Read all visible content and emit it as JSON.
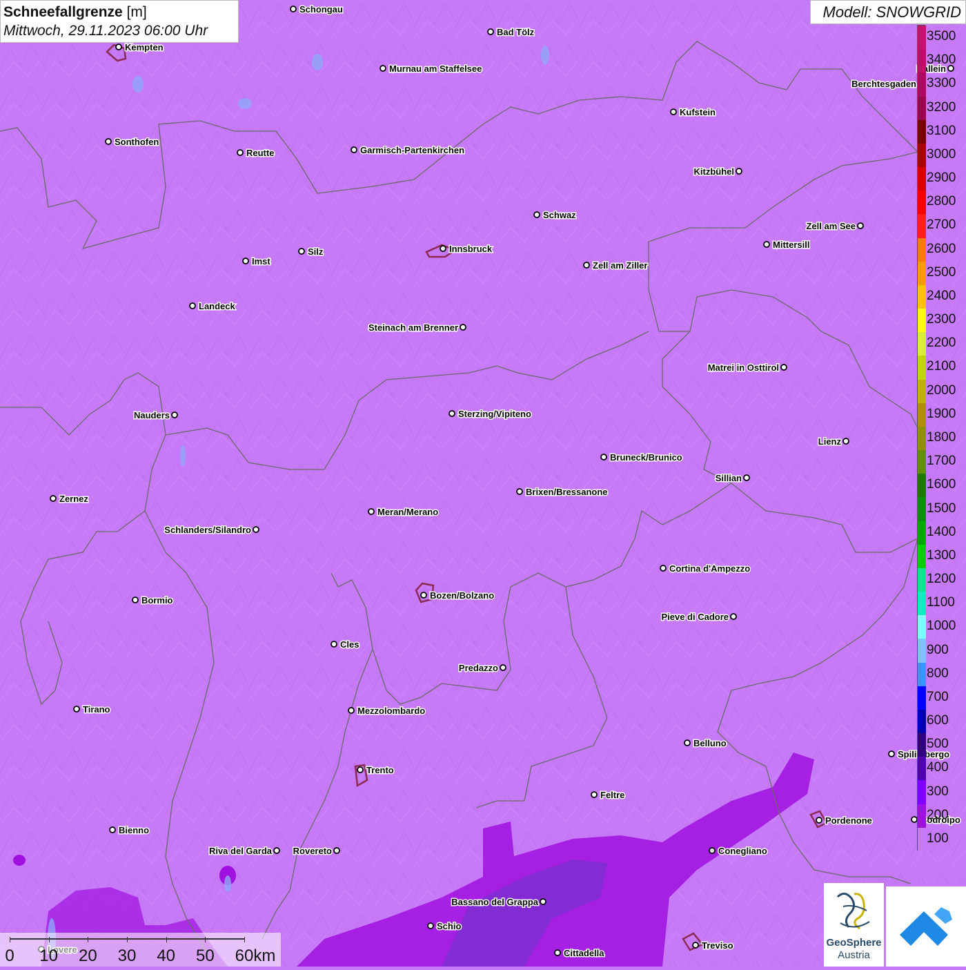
{
  "title": {
    "main": "Schneefallgrenze",
    "unit": "[m]",
    "datetime": "Mittwoch, 29.11.2023 06:00 Uhr"
  },
  "model": "Modell: SNOWGRID",
  "legend": [
    {
      "value": "3500",
      "color": "#c8106e"
    },
    {
      "value": "3400",
      "color": "#c00c68"
    },
    {
      "value": "3300",
      "color": "#b00860"
    },
    {
      "value": "3200",
      "color": "#9c0450"
    },
    {
      "value": "3100",
      "color": "#7a0000"
    },
    {
      "value": "3000",
      "color": "#a80000"
    },
    {
      "value": "2900",
      "color": "#d00000"
    },
    {
      "value": "2800",
      "color": "#f00000"
    },
    {
      "value": "2700",
      "color": "#ff2020"
    },
    {
      "value": "2600",
      "color": "#ff7a00"
    },
    {
      "value": "2500",
      "color": "#ff9a00"
    },
    {
      "value": "2400",
      "color": "#ffc000"
    },
    {
      "value": "2300",
      "color": "#ffff00"
    },
    {
      "value": "2200",
      "color": "#d8f030"
    },
    {
      "value": "2100",
      "color": "#c0d800"
    },
    {
      "value": "2000",
      "color": "#c0b000"
    },
    {
      "value": "1900",
      "color": "#b09000"
    },
    {
      "value": "1800",
      "color": "#909000"
    },
    {
      "value": "1700",
      "color": "#609000"
    },
    {
      "value": "1600",
      "color": "#207800"
    },
    {
      "value": "1500",
      "color": "#108a10"
    },
    {
      "value": "1400",
      "color": "#00a800"
    },
    {
      "value": "1300",
      "color": "#00d000"
    },
    {
      "value": "1200",
      "color": "#00e890"
    },
    {
      "value": "1100",
      "color": "#00f0c0"
    },
    {
      "value": "1000",
      "color": "#80ffff"
    },
    {
      "value": "900",
      "color": "#80c0ff"
    },
    {
      "value": "800",
      "color": "#4090ff"
    },
    {
      "value": "700",
      "color": "#0000ff"
    },
    {
      "value": "600",
      "color": "#0000b0"
    },
    {
      "value": "500",
      "color": "#300080"
    },
    {
      "value": "400",
      "color": "#5000b0"
    },
    {
      "value": "300",
      "color": "#8000ff"
    },
    {
      "value": "200",
      "color": "#a010e0"
    },
    {
      "value": "100",
      "color": "#c77af7"
    }
  ],
  "cities": [
    {
      "name": "Schongau"
    },
    {
      "name": "Bad Tölz"
    },
    {
      "name": "Kempten"
    },
    {
      "name": "Murnau am Staffelsee"
    },
    {
      "name": "Berchtesgaden"
    },
    {
      "name": "Hallein"
    },
    {
      "name": "Kufstein"
    },
    {
      "name": "Sonthofen"
    },
    {
      "name": "Reutte"
    },
    {
      "name": "Garmisch-Partenkirchen"
    },
    {
      "name": "Kitzbühel"
    },
    {
      "name": "Schwaz"
    },
    {
      "name": "Zell am See"
    },
    {
      "name": "Mittersill"
    },
    {
      "name": "Innsbruck"
    },
    {
      "name": "Silz"
    },
    {
      "name": "Imst"
    },
    {
      "name": "Zell am Ziller"
    },
    {
      "name": "Landeck"
    },
    {
      "name": "Steinach am Brenner"
    },
    {
      "name": "Matrei in Osttirol"
    },
    {
      "name": "Nauders"
    },
    {
      "name": "Sterzing/Vipiteno"
    },
    {
      "name": "Lienz"
    },
    {
      "name": "Bruneck/Brunico"
    },
    {
      "name": "Sillian"
    },
    {
      "name": "Zernez"
    },
    {
      "name": "Brixen/Bressanone"
    },
    {
      "name": "Meran/Merano"
    },
    {
      "name": "Schlanders/Silandro"
    },
    {
      "name": "Cortina d'Ampezzo"
    },
    {
      "name": "Bozen/Bolzano"
    },
    {
      "name": "Bormio"
    },
    {
      "name": "Pieve di Cadore"
    },
    {
      "name": "Cles"
    },
    {
      "name": "Predazzo"
    },
    {
      "name": "Tirano"
    },
    {
      "name": "Mezzolombardo"
    },
    {
      "name": "Belluno"
    },
    {
      "name": "Spilimbergo"
    },
    {
      "name": "Trento"
    },
    {
      "name": "Feltre"
    },
    {
      "name": "Pordenone"
    },
    {
      "name": "Bienno"
    },
    {
      "name": "Riva del Garda"
    },
    {
      "name": "Rovereto"
    },
    {
      "name": "Conegliano"
    },
    {
      "name": "Bassano del Grappa"
    },
    {
      "name": "Schio"
    },
    {
      "name": "Treviso"
    },
    {
      "name": "Cittadella"
    },
    {
      "name": "Lovere"
    },
    {
      "name": "Codroipo"
    }
  ],
  "scale": {
    "labels": [
      "0",
      "10",
      "20",
      "30",
      "40",
      "50",
      "60km"
    ]
  },
  "logos": {
    "geosphere_line1": "GeoSphere",
    "geosphere_line2": "Austria"
  }
}
